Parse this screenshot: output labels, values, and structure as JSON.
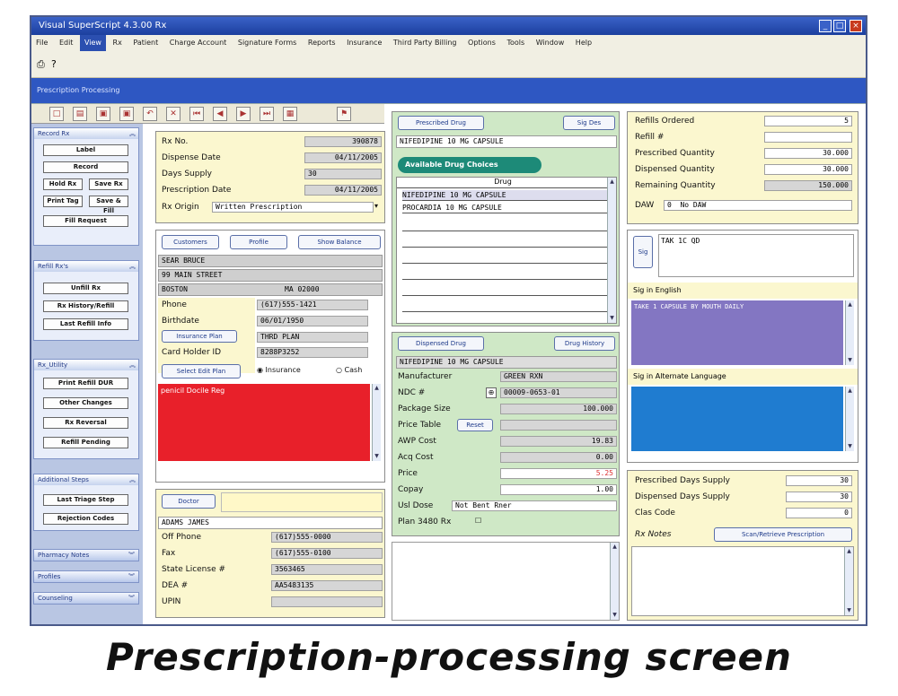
{
  "window": {
    "title": "Visual SuperScript 4.3.00 Rx",
    "controls": [
      "_",
      "□",
      "×"
    ]
  },
  "menu": {
    "items": [
      "File",
      "Edit",
      "View",
      "Rx",
      "Patient",
      "Charge Account",
      "Signature Forms",
      "Reports",
      "Insurance",
      "Third Party Billing",
      "Options",
      "Tools",
      "Window",
      "Help"
    ],
    "active_index": 2
  },
  "band": {
    "title": "Prescription Processing"
  },
  "nav": {
    "groups": [
      {
        "header": "Record Rx",
        "buttons": [
          "Label",
          "Record",
          "Hold Rx",
          "Save Rx",
          "Print Tag",
          "Save & Fill",
          "Fill Request"
        ]
      },
      {
        "header": "Refill Rx's",
        "buttons": [
          "Unfill Rx",
          "Rx History/Refill",
          "Last Refill Info"
        ]
      },
      {
        "header": "Rx_Utility",
        "buttons": [
          "Print Refill DUR",
          "Other Changes",
          "Rx Reversal",
          "Refill Pending"
        ]
      },
      {
        "header": "Additional Steps",
        "buttons": [
          "Last Triage Step",
          "Rejection Codes"
        ]
      }
    ],
    "collapsed": [
      "Pharmacy Notes",
      "Profiles",
      "Counseling"
    ]
  },
  "rx": {
    "number_label": "Rx No.",
    "number": "390878",
    "dispense_date_label": "Dispense Date",
    "dispense_date": "04/11/2005",
    "days_label": "Days Supply",
    "days": "30",
    "prescription_date_label": "Prescription Date",
    "prescription_date": "04/11/2005",
    "origin_label": "Rx Origin",
    "origin": "Written Prescription"
  },
  "patient": {
    "customers_btn": "Customers",
    "profile_btn": "Profile",
    "balance_btn": "Show Balance",
    "name": "SEAR  BRUCE",
    "address": "99 MAIN STREET",
    "city": "BOSTON",
    "state_zip": "MA 02000",
    "phone_label": "Phone",
    "phone": "(617)555-1421",
    "birthdate_label": "Birthdate",
    "birthdate": "06/01/1950",
    "insurance_btn": "Insurance Plan",
    "insurance": "THRD PLAN",
    "card_label": "Card Holder ID",
    "card": "8288P3252",
    "edit_btn": "Select Edit Plan",
    "radio_insurance": "Insurance",
    "radio_cash": "Cash",
    "alert_text": "penicil  Docile  Reg"
  },
  "doctor": {
    "doctor_btn": "Doctor",
    "name": "ADAMS  JAMES",
    "office_label": "Off Phone",
    "office": "(617)555-0000",
    "fax_label": "Fax",
    "fax": "(617)555-0100",
    "license_label": "State License #",
    "license": "3563465",
    "dea_label": "DEA #",
    "dea": "AA5483135",
    "upin_label": "UPIN"
  },
  "drug": {
    "prescribed_btn": "Prescribed Drug",
    "sig_btn": "Sig Des",
    "name": "NIFEDIPINE 10 MG CAPSULE",
    "choices_tab": "Available Drug Choices",
    "list_header": "Drug",
    "list": [
      "NIFEDIPINE 10 MG CAPSULE",
      "PROCARDIA 10 MG CAPSULE"
    ]
  },
  "dispensed": {
    "btn": "Dispensed Drug",
    "history_btn": "Drug History",
    "name": "NIFEDIPINE 10 MG CAPSULE",
    "manufacturer_label": "Manufacturer",
    "manufacturer": "GREEN RXN",
    "ndc_label": "NDC #",
    "ndc": "00009-0653-01",
    "package_label": "Package Size",
    "package": "100.000",
    "price_label": "Price Table",
    "price_btn": "Reset",
    "awp_label": "AWP Cost",
    "awp": "19.83",
    "acq_label": "Acq Cost",
    "acq": "0.00",
    "price2_label": "Price",
    "price2": "5.25",
    "copay_label": "Copay",
    "copay": "1.00",
    "usual_label": "Usl Dose",
    "usual": "Not Bent Rner",
    "plan_label": "Plan 3480 Rx"
  },
  "quantity": {
    "refills_label": "Refills Ordered",
    "refills": "5",
    "refill_label": "Refill #",
    "prescribed_label": "Prescribed Quantity",
    "prescribed": "30.000",
    "dispensed_label": "Dispensed Quantity",
    "dispensed": "30.000",
    "remaining_label": "Remaining Quantity",
    "remaining": "150.000",
    "daw_label": "DAW",
    "daw_value": "0",
    "daw_text": "No DAW"
  },
  "sig": {
    "sig_btn": "Sig",
    "text": "TAK 1C QD",
    "english_label": "Sig in English",
    "english": "TAKE 1 CAPSULE BY MOUTH DAILY",
    "other_label": "Sig in Alternate Language"
  },
  "supply": {
    "days_label": "Prescribed Days Supply",
    "days": "30",
    "dispensed_days_label": "Dispensed Days Supply",
    "dispensed_days": "30",
    "clas_label": "Clas Code",
    "clas": "0",
    "notes_label": "Rx Notes",
    "scan_btn": "Scan/Retrieve Prescription"
  },
  "caption": "Prescription-processing screen",
  "colors": {
    "alert": "#e8202a",
    "sig_english": "#8376c2",
    "sig_other": "#1f7cd0",
    "titlebar": "#1c3f9e"
  }
}
